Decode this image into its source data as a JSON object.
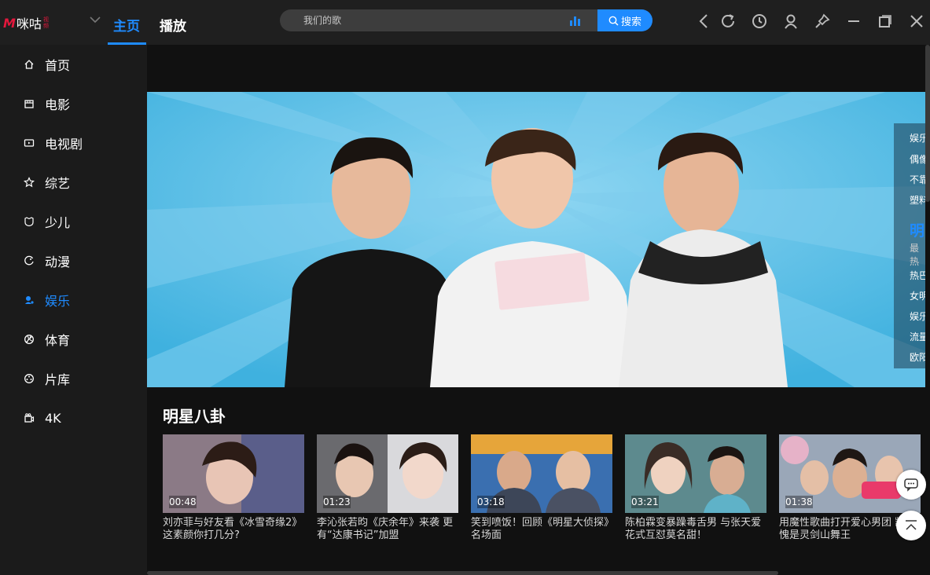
{
  "app": {
    "logo_main": "咪咕",
    "logo_sub": "视频"
  },
  "nav": {
    "tabs": [
      {
        "label": "主页"
      },
      {
        "label": "播放"
      }
    ]
  },
  "search": {
    "placeholder": "我们的歌",
    "button_label": "搜索"
  },
  "sidebar": {
    "items": [
      {
        "label": "首页",
        "icon": "home-icon"
      },
      {
        "label": "电影",
        "icon": "film-icon"
      },
      {
        "label": "电视剧",
        "icon": "tv-icon"
      },
      {
        "label": "综艺",
        "icon": "star-icon"
      },
      {
        "label": "少儿",
        "icon": "kids-icon"
      },
      {
        "label": "动漫",
        "icon": "anime-icon"
      },
      {
        "label": "娱乐",
        "icon": "entertainment-icon"
      },
      {
        "label": "体育",
        "icon": "sports-ball-icon"
      },
      {
        "label": "片库",
        "icon": "film-reel-icon"
      },
      {
        "label": "4K",
        "icon": "4k-icon"
      }
    ],
    "active_index": 6
  },
  "banner": {
    "side_items": [
      "娱乐",
      "偶像",
      "不靠",
      "塑料"
    ],
    "side_big": "明",
    "side_small": "最热",
    "side_items_2": [
      "热巴",
      "女明",
      "娱乐",
      "流量",
      "欧阳"
    ]
  },
  "section": {
    "title": "明星八卦"
  },
  "cards": [
    {
      "duration": "00:48",
      "title": "刘亦菲与好友看《冰雪奇缘2》 这素颜你打几分?"
    },
    {
      "duration": "01:23",
      "title": "李沁张若昀《庆余年》来袭 更有“达康书记”加盟"
    },
    {
      "duration": "03:18",
      "title": "笑到喷饭！回顾《明星大侦探》名场面"
    },
    {
      "duration": "03:21",
      "title": "陈柏霖变暴躁毒舌男 与张天爱花式互怼莫名甜！"
    },
    {
      "duration": "01:38",
      "title": "用魔性歌曲打开爱心男团 凯不愧是灵剑山舞王"
    }
  ],
  "colors": {
    "accent": "#1f8bff",
    "logo_red": "#e3173c",
    "banner_sky": "#4bbbe6"
  }
}
